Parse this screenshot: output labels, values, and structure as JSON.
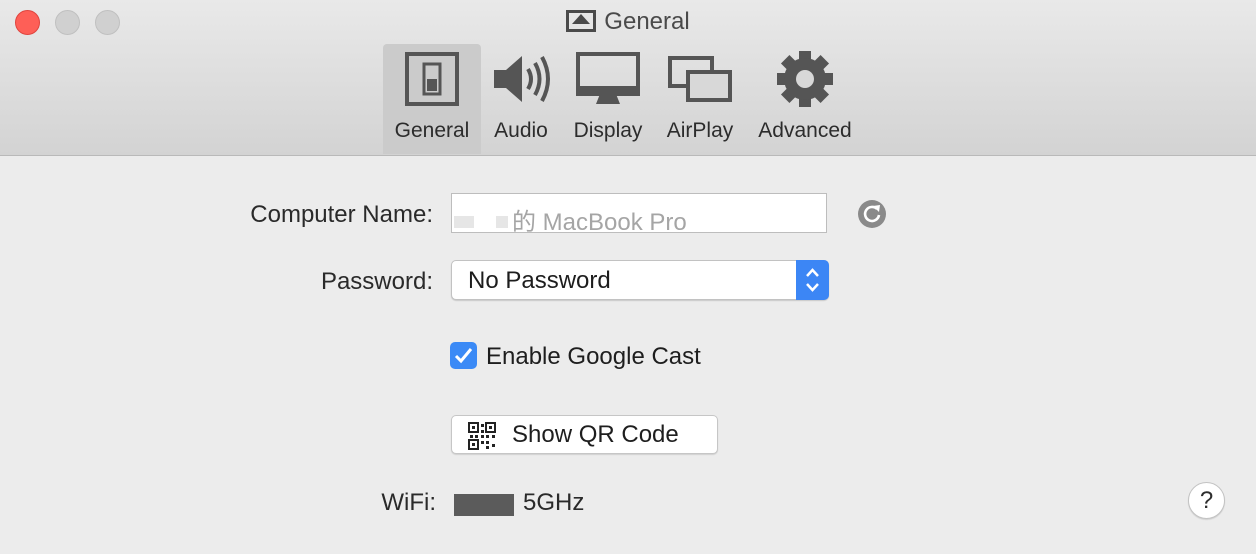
{
  "window": {
    "title": "General",
    "title_icon": "airplay-window-icon"
  },
  "toolbar": {
    "tabs": [
      {
        "label": "General",
        "icon": "switch-icon",
        "active": true
      },
      {
        "label": "Audio",
        "icon": "speaker-icon",
        "active": false
      },
      {
        "label": "Display",
        "icon": "monitor-icon",
        "active": false
      },
      {
        "label": "AirPlay",
        "icon": "airplay-icon",
        "active": false
      },
      {
        "label": "Advanced",
        "icon": "gear-icon",
        "active": false
      }
    ]
  },
  "form": {
    "computer_name_label": "Computer Name:",
    "computer_name_value": "的 MacBook Pro",
    "password_label": "Password:",
    "password_value": "No Password",
    "google_cast_label": "Enable Google Cast",
    "google_cast_checked": true,
    "qr_button_label": "Show QR Code",
    "wifi_label": "WiFi:",
    "wifi_value": "5GHz"
  },
  "help": {
    "label": "?"
  },
  "colors": {
    "accent": "#3b8af6",
    "close": "#fe5f57"
  }
}
